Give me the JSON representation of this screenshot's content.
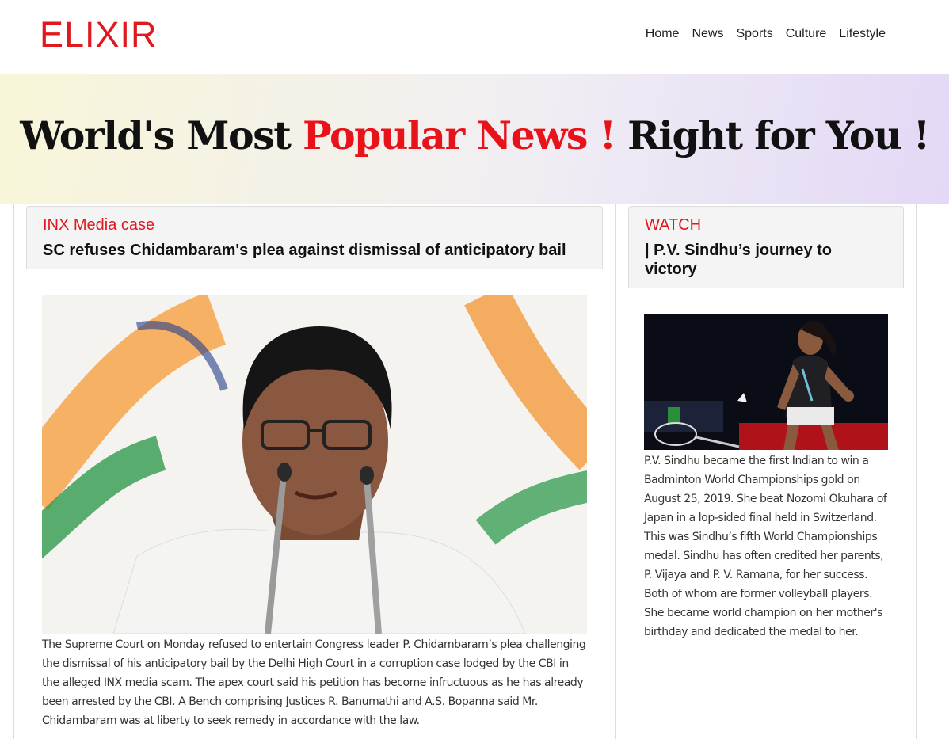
{
  "header": {
    "logo": "ELIXIR",
    "nav": [
      "Home",
      "News",
      "Sports",
      "Culture",
      "Lifestyle"
    ]
  },
  "hero": {
    "part1": "World's Most ",
    "accent": "Popular News !",
    "part2": " Right for You !"
  },
  "main_story": {
    "kicker": "INX Media case",
    "headline": "SC refuses Chidambaram's plea against dismissal of anticipatory bail",
    "image": "Photo of P. Chidambaram speaking at microphones",
    "body": "The Supreme Court on Monday refused to entertain Congress leader P. Chidambaram’s plea challenging the dismissal of his anticipatory bail by the Delhi High Court in a corruption case lodged by the CBI in the alleged INX media scam. The apex court said his petition has become infructuous as he has already been arrested by the CBI. A Bench comprising Justices R. Banumathi and A.S. Bopanna said Mr. Chidambaram was at liberty to seek remedy in accordance with the law."
  },
  "side_story": {
    "kicker": "WATCH",
    "headline": "| P.V. Sindhu’s journey to victory",
    "image": "Photo of P.V. Sindhu celebrating on badminton court",
    "body": "P.V. Sindhu became the first Indian to win a Badminton World Championships gold on August 25, 2019. She beat Nozomi Okuhara of Japan in a lop-sided final held in Switzerland. This was Sindhu’s fifth World Championships medal. Sindhu has often credited her parents, P. Vijaya and P. V. Ramana, for her success. Both of whom are former volleyball players. She became world champion on her mother's birthday and dedicated the medal to her."
  },
  "colors": {
    "brand_red": "#e0191e",
    "hero_accent": "#e8121a",
    "card_header_bg": "#f4f4f4"
  }
}
